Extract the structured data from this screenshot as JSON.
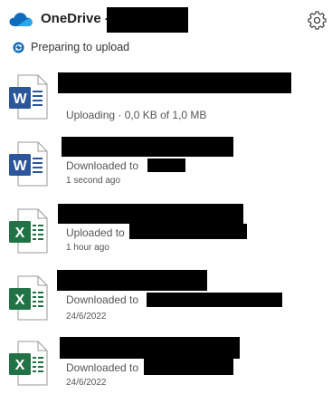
{
  "header": {
    "title": "OneDrive -"
  },
  "status": {
    "text": "Preparing to upload"
  },
  "files": [
    {
      "type": "word",
      "status": "Uploading · 0,0 KB of 1,0 MB",
      "time": ""
    },
    {
      "type": "word",
      "status": "Downloaded to",
      "time": "1 second ago"
    },
    {
      "type": "excel",
      "status": "Uploaded to",
      "time": "1 hour ago"
    },
    {
      "type": "excel",
      "status": "Downloaded to",
      "time": "24/6/2022"
    },
    {
      "type": "excel",
      "status": "Downloaded to",
      "time": "24/6/2022"
    }
  ],
  "colors": {
    "word": "#2b579a",
    "excel": "#217346",
    "accent": "#0f6cbd"
  },
  "icons": {
    "logo": "onedrive-cloud-icon",
    "settings": "gear-icon",
    "sync": "sync-icon"
  }
}
